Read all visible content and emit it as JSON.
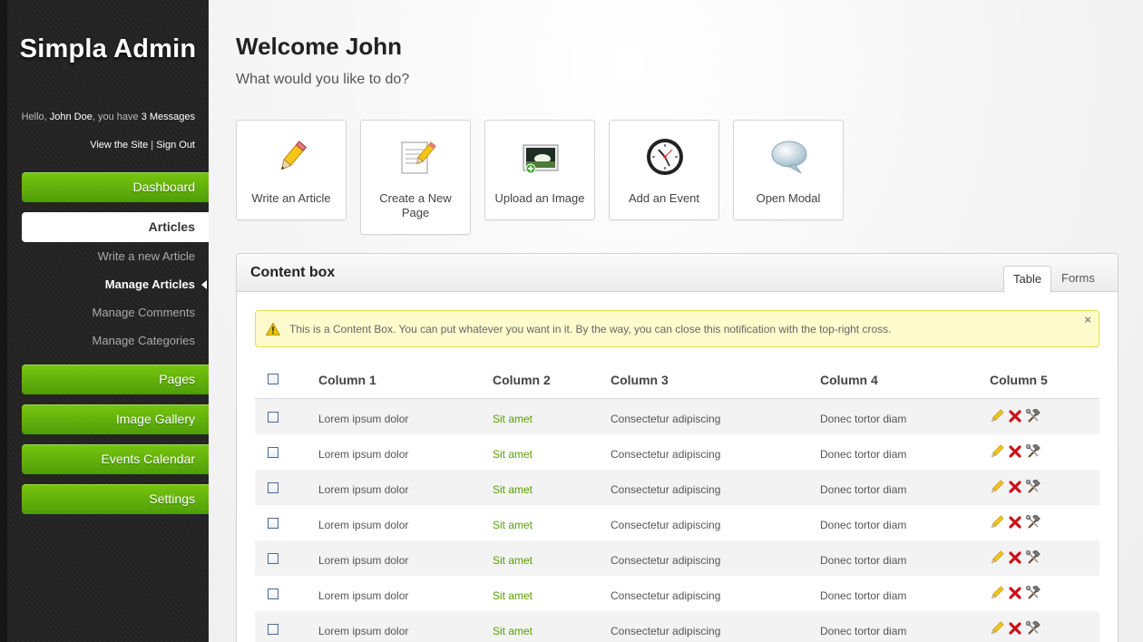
{
  "sidebar": {
    "brand": "Simpla Admin",
    "profile": {
      "greeting": "Hello,",
      "user": "John Doe",
      "middle": ", you have",
      "messages": "3 Messages",
      "view_site": "View the Site",
      "separator": "|",
      "sign_out": "Sign Out"
    },
    "nav": {
      "dashboard": "Dashboard",
      "articles": "Articles",
      "articles_sub": [
        "Write a new Article",
        "Manage Articles",
        "Manage Comments",
        "Manage Categories"
      ],
      "pages": "Pages",
      "gallery": "Image Gallery",
      "events": "Events Calendar",
      "settings": "Settings"
    },
    "colors": {
      "nav_green": "#5fb10a",
      "bg": "#232323"
    }
  },
  "main": {
    "title": "Welcome John",
    "subtitle": "What would you like to do?",
    "shortcuts": [
      {
        "label": "Write an Article",
        "icon": "pencil-icon"
      },
      {
        "label": "Create a New Page",
        "icon": "notepad-icon"
      },
      {
        "label": "Upload an Image",
        "icon": "image-upload-icon"
      },
      {
        "label": "Add an Event",
        "icon": "clock-icon"
      },
      {
        "label": "Open Modal",
        "icon": "speech-bubble-icon"
      }
    ]
  },
  "content_box": {
    "title": "Content box",
    "tabs": [
      "Table",
      "Forms"
    ],
    "notice": "This is a Content Box. You can put whatever you want in it. By the way, you can close this notification with the top-right cross.",
    "close_glyph": "×",
    "columns": [
      "Column 1",
      "Column 2",
      "Column 3",
      "Column 4",
      "Column 5"
    ],
    "rows": [
      [
        "Lorem ipsum dolor",
        "Sit amet",
        "Consectetur adipiscing",
        "Donec tortor diam"
      ],
      [
        "Lorem ipsum dolor",
        "Sit amet",
        "Consectetur adipiscing",
        "Donec tortor diam"
      ],
      [
        "Lorem ipsum dolor",
        "Sit amet",
        "Consectetur adipiscing",
        "Donec tortor diam"
      ],
      [
        "Lorem ipsum dolor",
        "Sit amet",
        "Consectetur adipiscing",
        "Donec tortor diam"
      ],
      [
        "Lorem ipsum dolor",
        "Sit amet",
        "Consectetur adipiscing",
        "Donec tortor diam"
      ],
      [
        "Lorem ipsum dolor",
        "Sit amet",
        "Consectetur adipiscing",
        "Donec tortor diam"
      ],
      [
        "Lorem ipsum dolor",
        "Sit amet",
        "Consectetur adipiscing",
        "Donec tortor diam"
      ]
    ],
    "row_actions": [
      "edit-pencil-icon",
      "delete-cross-icon",
      "tools-hammer-icon"
    ],
    "colors": {
      "link": "#57a000",
      "notice_bg": "#fffbcc"
    }
  }
}
